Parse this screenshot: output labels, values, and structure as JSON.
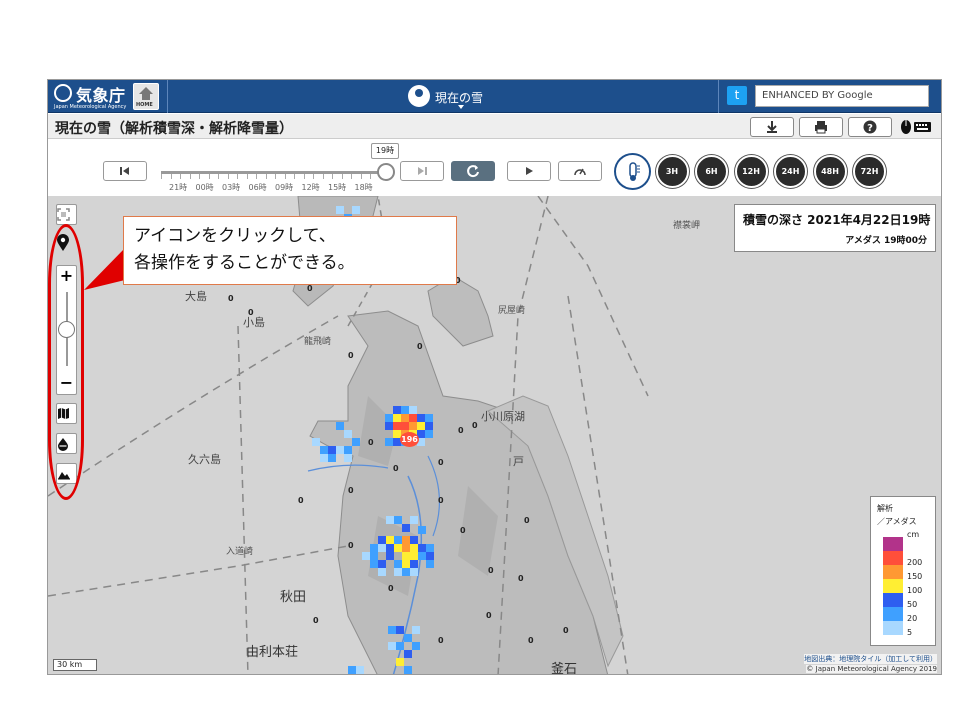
{
  "header": {
    "logo_name": "気象庁",
    "logo_sub": "Japan Meteorological Agency",
    "home_label": "HOME",
    "center_title": "現在の雪",
    "search_placeholder": "ENHANCED BY Google"
  },
  "titlebar": {
    "title": "現在の雪（解析積雪深・解析降雪量）",
    "buttons": [
      "download-icon",
      "print-icon",
      "help-icon",
      "mouse-keyboard-icon"
    ]
  },
  "timebar": {
    "current_time_tip": "19時",
    "tick_labels": [
      "21時",
      "00時",
      "03時",
      "06時",
      "09時",
      "12時",
      "15時",
      "18時"
    ],
    "slider_position": 1.0,
    "round_buttons": [
      {
        "label": "",
        "icon": "snow-depth-icon",
        "active": true
      },
      {
        "label": "3H"
      },
      {
        "label": "6H"
      },
      {
        "label": "12H"
      },
      {
        "label": "24H"
      },
      {
        "label": "48H"
      },
      {
        "label": "72H"
      }
    ]
  },
  "map": {
    "info_title": "積雪の深さ  2021年4月22日19時",
    "info_sub": "アメダス  19時00分",
    "max_label": "196",
    "zero_label": "0",
    "places": {
      "oshima": "大島",
      "kojima": "小島",
      "tappizaki": "龍飛崎",
      "shiriyazaki": "尻屋崎",
      "ogawarako": "小川原湖",
      "kurokamishima": "久六島",
      "nyudozaki": "入道崎",
      "akita": "秋田",
      "yurihonjo": "由利本荘",
      "kamaishi": "釜石",
      "hachinohe": "戸",
      "todogasaki": "襟裳岬"
    },
    "legend": {
      "header1": "解析",
      "header2": "／アメダス",
      "unit": "cm",
      "levels": [
        {
          "label": "",
          "color": "#b2338a"
        },
        {
          "label": "200",
          "color": "#ff4f3a"
        },
        {
          "label": "150",
          "color": "#ff9933"
        },
        {
          "label": "100",
          "color": "#ffee33"
        },
        {
          "label": "50",
          "color": "#2e5ef0"
        },
        {
          "label": "20",
          "color": "#3fa0ff"
        },
        {
          "label": "5",
          "color": "#a8d8ff"
        }
      ]
    },
    "scale_label": "30 km",
    "credit1": "地図出典：地理院タイル（加工して利用）",
    "credit2": "© Japan Meteorological Agency 2019"
  },
  "annotation": {
    "line1": "アイコンをクリックして、",
    "line2": "各操作をすることができる。"
  }
}
